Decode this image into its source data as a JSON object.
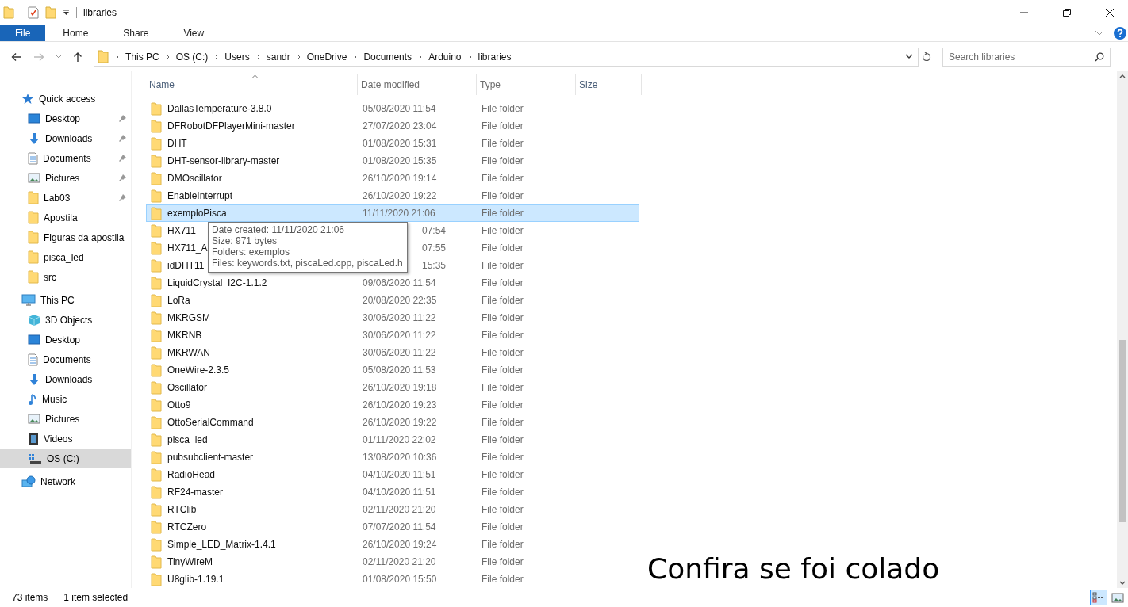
{
  "window": {
    "title": "libraries"
  },
  "ribbon": {
    "tabs": [
      {
        "label": "File",
        "kind": "file",
        "selected": false
      },
      {
        "label": "Home",
        "kind": "tab",
        "selected": false
      },
      {
        "label": "Share",
        "kind": "tab",
        "selected": false
      },
      {
        "label": "View",
        "kind": "tab",
        "selected": false
      }
    ]
  },
  "address": {
    "segments": [
      "This PC",
      "OS (C:)",
      "Users",
      "sandr",
      "OneDrive",
      "Documents",
      "Arduino",
      "libraries"
    ],
    "search_placeholder": "Search libraries"
  },
  "sidebar": {
    "items": [
      {
        "label": "Quick access",
        "kind": "quick",
        "pinned": false,
        "selected": false,
        "children": [
          {
            "label": "Desktop",
            "kind": "desktop",
            "pinned": true,
            "selected": false
          },
          {
            "label": "Downloads",
            "kind": "downloads",
            "pinned": true,
            "selected": false
          },
          {
            "label": "Documents",
            "kind": "documents",
            "pinned": true,
            "selected": false
          },
          {
            "label": "Pictures",
            "kind": "pictures",
            "pinned": true,
            "selected": false
          },
          {
            "label": "Lab03",
            "kind": "folder",
            "pinned": true,
            "selected": false
          },
          {
            "label": "Apostila",
            "kind": "folder",
            "pinned": false,
            "selected": false
          },
          {
            "label": "Figuras da apostila",
            "kind": "folder",
            "pinned": false,
            "selected": false
          },
          {
            "label": "pisca_led",
            "kind": "folder",
            "pinned": false,
            "selected": false
          },
          {
            "label": "src",
            "kind": "folder",
            "pinned": false,
            "selected": false
          }
        ]
      },
      {
        "label": "This PC",
        "kind": "pc",
        "pinned": false,
        "selected": false,
        "children": [
          {
            "label": "3D Objects",
            "kind": "objects",
            "pinned": false,
            "selected": false
          },
          {
            "label": "Desktop",
            "kind": "desktop",
            "pinned": false,
            "selected": false
          },
          {
            "label": "Documents",
            "kind": "documents",
            "pinned": false,
            "selected": false
          },
          {
            "label": "Downloads",
            "kind": "downloads",
            "pinned": false,
            "selected": false
          },
          {
            "label": "Music",
            "kind": "music",
            "pinned": false,
            "selected": false
          },
          {
            "label": "Pictures",
            "kind": "pictures",
            "pinned": false,
            "selected": false
          },
          {
            "label": "Videos",
            "kind": "videos",
            "pinned": false,
            "selected": false
          },
          {
            "label": "OS (C:)",
            "kind": "drive",
            "pinned": false,
            "selected": true
          }
        ]
      },
      {
        "label": "Network",
        "kind": "network",
        "pinned": false,
        "selected": false
      }
    ]
  },
  "table": {
    "columns": [
      {
        "label": "Name",
        "sorted": true
      },
      {
        "label": "Date modified",
        "sorted": false
      },
      {
        "label": "Type",
        "sorted": false
      },
      {
        "label": "Size",
        "sorted": false
      }
    ],
    "rows": [
      {
        "name": "DallasTemperature-3.8.0",
        "date": "05/08/2020 11:54",
        "type": "File folder",
        "selected": false,
        "covered": false
      },
      {
        "name": "DFRobotDFPlayerMini-master",
        "date": "27/07/2020 23:04",
        "type": "File folder",
        "selected": false,
        "covered": false
      },
      {
        "name": "DHT",
        "date": "01/08/2020 15:31",
        "type": "File folder",
        "selected": false,
        "covered": false
      },
      {
        "name": "DHT-sensor-library-master",
        "date": "01/08/2020 15:35",
        "type": "File folder",
        "selected": false,
        "covered": false
      },
      {
        "name": "DMOscillator",
        "date": "26/10/2020 19:14",
        "type": "File folder",
        "selected": false,
        "covered": false
      },
      {
        "name": "EnableInterrupt",
        "date": "26/10/2020 19:22",
        "type": "File folder",
        "selected": false,
        "covered": false
      },
      {
        "name": "exemploPisca",
        "date": "11/11/2020 21:06",
        "type": "File folder",
        "selected": true,
        "covered": false
      },
      {
        "name": "HX711",
        "date": "07:54",
        "type": "File folder",
        "selected": false,
        "covered": true
      },
      {
        "name": "HX711_A",
        "date": "07:55",
        "type": "File folder",
        "selected": false,
        "covered": true
      },
      {
        "name": "idDHT11",
        "date": "15:35",
        "type": "File folder",
        "selected": false,
        "covered": true
      },
      {
        "name": "LiquidCrystal_I2C-1.1.2",
        "date": "09/06/2020 11:54",
        "type": "File folder",
        "selected": false,
        "covered": false
      },
      {
        "name": "LoRa",
        "date": "20/08/2020 22:35",
        "type": "File folder",
        "selected": false,
        "covered": false
      },
      {
        "name": "MKRGSM",
        "date": "30/06/2020 11:22",
        "type": "File folder",
        "selected": false,
        "covered": false
      },
      {
        "name": "MKRNB",
        "date": "30/06/2020 11:22",
        "type": "File folder",
        "selected": false,
        "covered": false
      },
      {
        "name": "MKRWAN",
        "date": "30/06/2020 11:22",
        "type": "File folder",
        "selected": false,
        "covered": false
      },
      {
        "name": "OneWire-2.3.5",
        "date": "05/08/2020 11:53",
        "type": "File folder",
        "selected": false,
        "covered": false
      },
      {
        "name": "Oscillator",
        "date": "26/10/2020 19:18",
        "type": "File folder",
        "selected": false,
        "covered": false
      },
      {
        "name": "Otto9",
        "date": "26/10/2020 19:23",
        "type": "File folder",
        "selected": false,
        "covered": false
      },
      {
        "name": "OttoSerialCommand",
        "date": "26/10/2020 19:22",
        "type": "File folder",
        "selected": false,
        "covered": false
      },
      {
        "name": "pisca_led",
        "date": "01/11/2020 22:02",
        "type": "File folder",
        "selected": false,
        "covered": false
      },
      {
        "name": "pubsubclient-master",
        "date": "13/08/2020 10:36",
        "type": "File folder",
        "selected": false,
        "covered": false
      },
      {
        "name": "RadioHead",
        "date": "04/10/2020 11:51",
        "type": "File folder",
        "selected": false,
        "covered": false
      },
      {
        "name": "RF24-master",
        "date": "04/10/2020 11:51",
        "type": "File folder",
        "selected": false,
        "covered": false
      },
      {
        "name": "RTClib",
        "date": "02/11/2020 21:20",
        "type": "File folder",
        "selected": false,
        "covered": false
      },
      {
        "name": "RTCZero",
        "date": "07/07/2020 11:54",
        "type": "File folder",
        "selected": false,
        "covered": false
      },
      {
        "name": "Simple_LED_Matrix-1.4.1",
        "date": "26/10/2020 19:24",
        "type": "File folder",
        "selected": false,
        "covered": false
      },
      {
        "name": "TinyWireM",
        "date": "02/11/2020 21:20",
        "type": "File folder",
        "selected": false,
        "covered": false
      },
      {
        "name": "U8glib-1.19.1",
        "date": "01/08/2020 15:50",
        "type": "File folder",
        "selected": false,
        "covered": false
      }
    ]
  },
  "tooltip": {
    "lines": [
      "Date created: 11/11/2020 21:06",
      "Size: 971 bytes",
      "Folders: exemplos",
      "Files: keywords.txt, piscaLed.cpp, piscaLed.h"
    ]
  },
  "caption": "Confira se foi colado",
  "status_bar": {
    "count": "73 items",
    "selection": "1 item selected",
    "views": [
      {
        "kind": "details",
        "selected": true
      },
      {
        "kind": "thumbnails",
        "selected": false
      }
    ]
  }
}
